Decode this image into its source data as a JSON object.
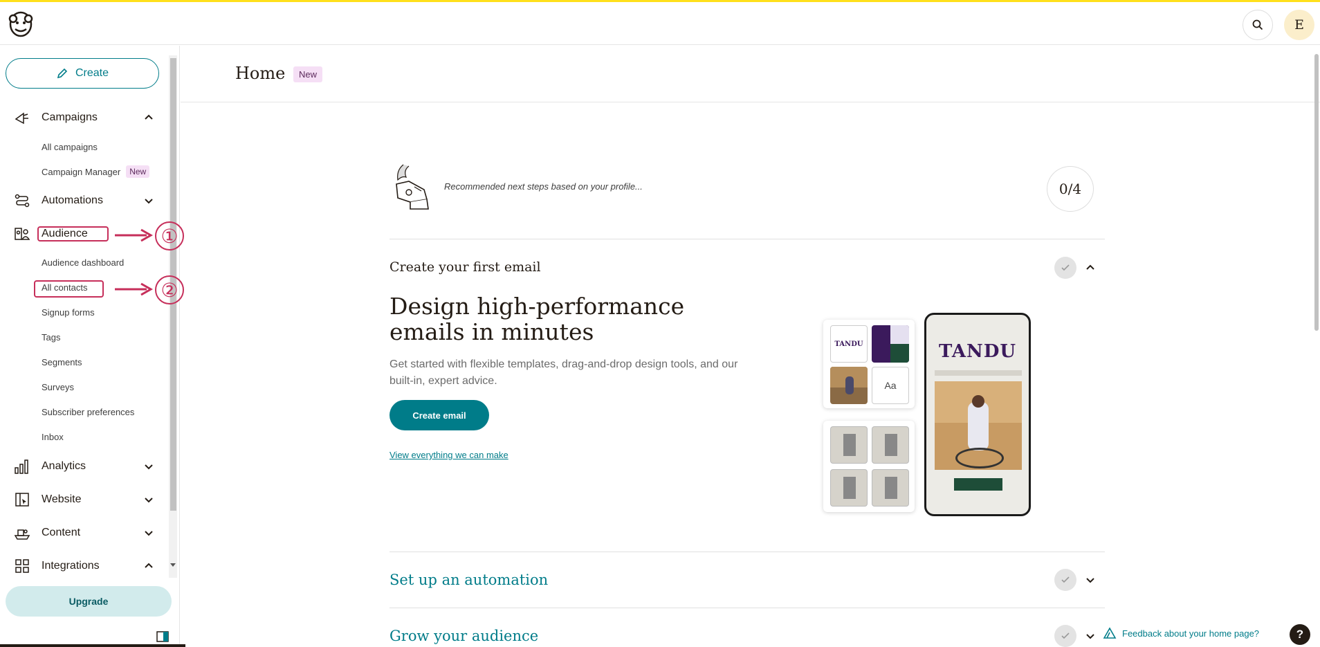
{
  "app": {
    "avatar_initial": "E",
    "accent": "#007c89",
    "brand_yellow": "#ffe01b"
  },
  "sidebar": {
    "create_label": "Create",
    "campaigns": {
      "label": "Campaigns",
      "items": [
        "All campaigns",
        "Campaign Manager"
      ],
      "new_badge": "New"
    },
    "automations": {
      "label": "Automations"
    },
    "audience": {
      "label": "Audience",
      "items": [
        "Audience dashboard",
        "All contacts",
        "Signup forms",
        "Tags",
        "Segments",
        "Surveys",
        "Subscriber preferences",
        "Inbox"
      ]
    },
    "analytics": {
      "label": "Analytics"
    },
    "website": {
      "label": "Website"
    },
    "content": {
      "label": "Content"
    },
    "integrations": {
      "label": "Integrations"
    },
    "upgrade_label": "Upgrade"
  },
  "annotations": {
    "one": "①",
    "two": "②",
    "color": "#c62e5a"
  },
  "header": {
    "title": "Home",
    "badge": "New"
  },
  "main": {
    "recommendation": "Recommended next steps based on your profile...",
    "progress": "0/4",
    "sections": [
      {
        "title": "Create your first email",
        "expanded": true
      },
      {
        "title": "Set up an automation",
        "expanded": false
      },
      {
        "title": "Grow your audience",
        "expanded": false
      }
    ],
    "email": {
      "heading": "Design high-performance emails in minutes",
      "description": "Get started with flexible templates, drag-and-drop design tools, and our built-in, expert advice.",
      "cta": "Create email",
      "link": "View everything we can make"
    },
    "illustration": {
      "brand": "TANDU",
      "brand_small": "TANDU",
      "font_sample": "Aa"
    }
  },
  "footer": {
    "feedback": "Feedback about your home page?",
    "help": "?"
  }
}
